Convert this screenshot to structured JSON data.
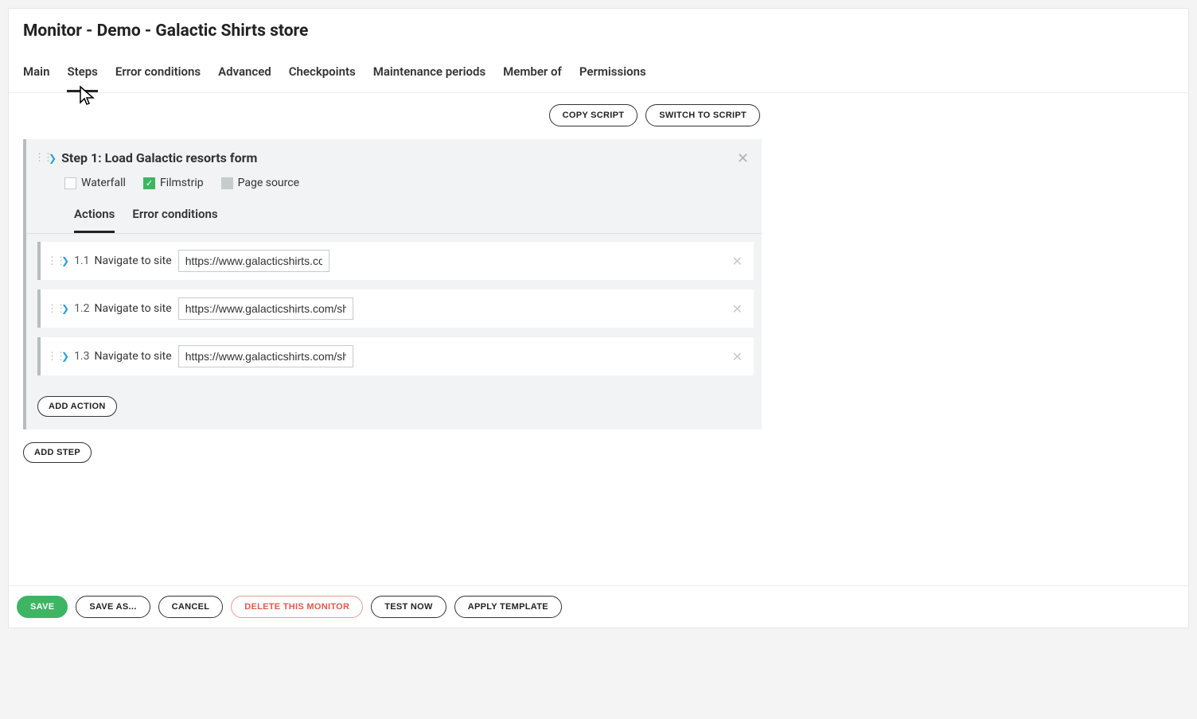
{
  "page_title": "Monitor - Demo - Galactic Shirts store",
  "tabs": {
    "main": "Main",
    "steps": "Steps",
    "error_conditions": "Error conditions",
    "advanced": "Advanced",
    "checkpoints": "Checkpoints",
    "maintenance": "Maintenance periods",
    "member_of": "Member of",
    "permissions": "Permissions"
  },
  "top_buttons": {
    "copy_script": "COPY SCRIPT",
    "switch_to_script": "SWITCH TO SCRIPT"
  },
  "step": {
    "title": "Step 1: Load Galactic resorts form",
    "options": {
      "waterfall": "Waterfall",
      "filmstrip": "Filmstrip",
      "page_source": "Page source"
    },
    "sub_tabs": {
      "actions": "Actions",
      "error_conditions": "Error conditions"
    },
    "actions": [
      {
        "num": "1.1",
        "label": "Navigate to site",
        "url": "https://www.galacticshirts.com"
      },
      {
        "num": "1.2",
        "label": "Navigate to site",
        "url": "https://www.galacticshirts.com/shop"
      },
      {
        "num": "1.3",
        "label": "Navigate to site",
        "url": "https://www.galacticshirts.com/shop"
      }
    ],
    "add_action": "ADD ACTION"
  },
  "add_step": "ADD STEP",
  "footer": {
    "save": "SAVE",
    "save_as": "SAVE AS...",
    "cancel": "CANCEL",
    "delete": "DELETE THIS MONITOR",
    "test_now": "TEST NOW",
    "apply_template": "APPLY TEMPLATE"
  }
}
